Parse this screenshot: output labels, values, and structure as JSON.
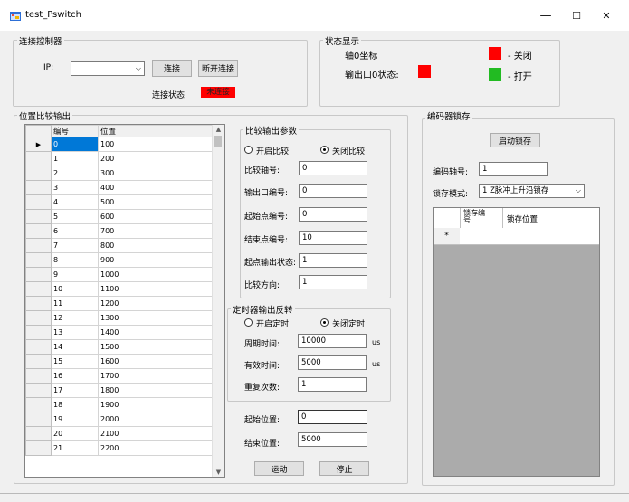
{
  "window": {
    "title": "test_Pswitch",
    "min_glyph": "—",
    "max_glyph": "☐",
    "close_glyph": "✕"
  },
  "connect": {
    "group_title": "连接控制器",
    "ip_label": "IP:",
    "ip_value": "",
    "connect_button": "连接",
    "disconnect_button": "断开连接",
    "status_label": "连接状态:",
    "status_value": "未连接",
    "status_color": "#ff0000"
  },
  "status": {
    "group_title": "状态显示",
    "axis_label": "轴0坐标",
    "output_label": "输出口0状态:",
    "output_color": "#ff0000",
    "legend_closed": "- 关闭",
    "legend_open": "- 打开",
    "closed_color": "#ff0000",
    "open_color": "#22bb22"
  },
  "position": {
    "group_title": "位置比较输出",
    "col_index": "编号",
    "col_position": "位置",
    "rows": [
      [
        "0",
        "100"
      ],
      [
        "1",
        "200"
      ],
      [
        "2",
        "300"
      ],
      [
        "3",
        "400"
      ],
      [
        "4",
        "500"
      ],
      [
        "5",
        "600"
      ],
      [
        "6",
        "700"
      ],
      [
        "7",
        "800"
      ],
      [
        "8",
        "900"
      ],
      [
        "9",
        "1000"
      ],
      [
        "10",
        "1100"
      ],
      [
        "11",
        "1200"
      ],
      [
        "12",
        "1300"
      ],
      [
        "13",
        "1400"
      ],
      [
        "14",
        "1500"
      ],
      [
        "15",
        "1600"
      ],
      [
        "16",
        "1700"
      ],
      [
        "17",
        "1800"
      ],
      [
        "18",
        "1900"
      ],
      [
        "19",
        "2000"
      ],
      [
        "20",
        "2100"
      ],
      [
        "21",
        "2200"
      ]
    ]
  },
  "compare": {
    "group_title": "比较输出参数",
    "radio_enable": "开启比较",
    "radio_disable": "关闭比较",
    "axis_label": "比较轴号:",
    "axis_value": "0",
    "output_label": "输出口编号:",
    "output_value": "0",
    "start_label": "起始点编号:",
    "start_value": "0",
    "end_label": "结束点编号:",
    "end_value": "10",
    "start_state_label": "起点输出状态:",
    "start_state_value": "1",
    "direction_label": "比较方向:",
    "direction_value": "1"
  },
  "timer": {
    "group_title": "定时器输出反转",
    "radio_enable": "开启定时",
    "radio_disable": "关闭定时",
    "period_label": "周期时间:",
    "period_value": "10000",
    "period_unit": "us",
    "valid_label": "有效时间:",
    "valid_value": "5000",
    "valid_unit": "us",
    "repeat_label": "重复次数:",
    "repeat_value": "1"
  },
  "motion": {
    "start_label": "起始位置:",
    "start_value": "0",
    "end_label": "结束位置:",
    "end_value": "5000",
    "run_button": "运动",
    "stop_button": "停止"
  },
  "encoder": {
    "group_title": "编码器锁存",
    "start_button": "启动锁存",
    "axis_label": "编码轴号:",
    "axis_value": "1",
    "mode_label": "锁存模式:",
    "mode_value": "1 Z脉冲上升沿锁存",
    "col_index": "锁存编号",
    "col_position": "锁存位置",
    "new_row_marker": "*"
  }
}
